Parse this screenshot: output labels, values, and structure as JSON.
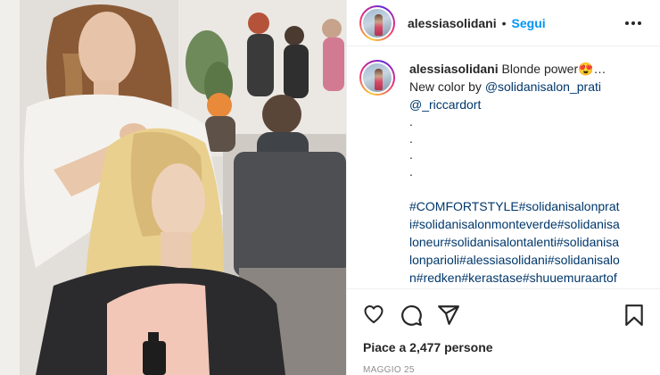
{
  "post": {
    "username": "alessiasolidani",
    "separator": "•",
    "follow_label": "Segui",
    "more_icon": "more-options-icon"
  },
  "caption": {
    "username": "alessiasolidani",
    "line1": "Blonde power😍…",
    "line2_prefix": "New color by ",
    "mention1": "@solidanisalon_prati",
    "mention2": "@_riccardort",
    "dots": [
      ".",
      ".",
      ".",
      "."
    ],
    "hashtags": "#COMFORTSTYLE#solidanisalonprati#solidanisalonmonteverde#solidanisaloneur#solidanisalontalenti#solidanisalonparioli#alessiasolidani#solidanisalon#redken#kerastase#shuuemuraartofhair#goodprofessional#redke"
  },
  "actions": {
    "like_icon": "heart-icon",
    "comment_icon": "comment-icon",
    "share_icon": "share-icon",
    "save_icon": "bookmark-icon"
  },
  "likes_text": "Piace a 2,477 persone",
  "date_text": "MAGGIO 25",
  "colors": {
    "link": "#00376b",
    "follow": "#0095f6",
    "text": "#262626",
    "muted": "#8e8e8e"
  }
}
